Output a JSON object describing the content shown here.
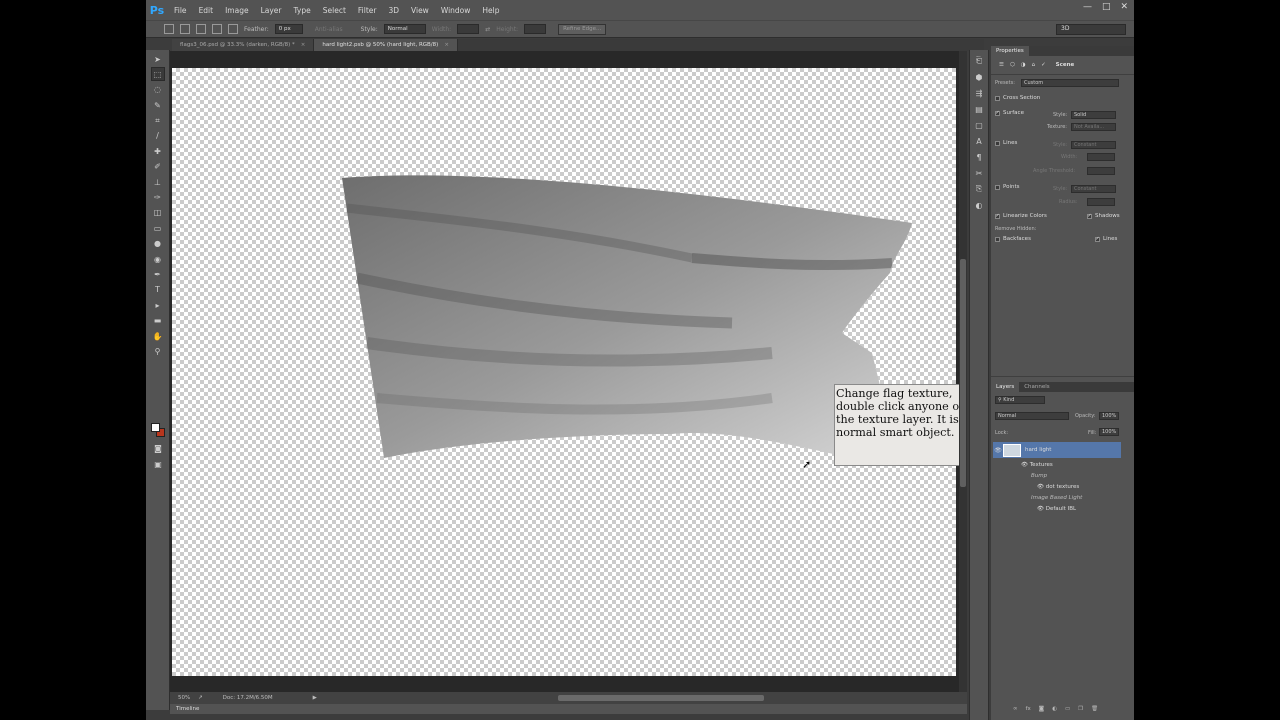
{
  "app": {
    "logo": "Ps"
  },
  "menu": [
    "File",
    "Edit",
    "Image",
    "Layer",
    "Type",
    "Select",
    "Filter",
    "3D",
    "View",
    "Window",
    "Help"
  ],
  "window_controls": {
    "minimize": "—",
    "maximize": "□",
    "close": "✕"
  },
  "options": {
    "feather_label": "Feather:",
    "feather_value": "0 px",
    "antialias_label": "Anti-alias",
    "style_label": "Style:",
    "style_value": "Normal",
    "width_label": "Width:",
    "height_label": "Height:",
    "refine_edge": "Refine Edge...",
    "workspace": "3D"
  },
  "tabs": [
    {
      "label": "flags3_06.psd @ 33.3% (darken, RGB/8) *",
      "close": "×"
    },
    {
      "label": "hard light2.psb @ 50% (hard light, RGB/8)",
      "close": "×"
    }
  ],
  "tooltip": "Change flag texture, double click anyone of the texture layer. It is normal smart object.",
  "status": {
    "zoom": "50%",
    "doc": "Doc: 17.2M/6.50M",
    "timeline": "Timeline"
  },
  "properties": {
    "tab": "Properties",
    "scene_label": "Scene",
    "presets_label": "Presets:",
    "presets_value": "Custom",
    "cross_section": "Cross Section",
    "surface": "Surface",
    "surface_style_label": "Style:",
    "surface_style_value": "Solid",
    "texture_label": "Texture:",
    "texture_value": "Not Availa...",
    "lines": "Lines",
    "lines_style_label": "Style:",
    "lines_style_value": "Constant",
    "width_label": "Width:",
    "angle_label": "Angle Threshold:",
    "points": "Points",
    "points_style_label": "Style:",
    "points_style_value": "Constant",
    "radius_label": "Radius:",
    "linearize": "Linearize Colors",
    "shadows": "Shadows",
    "remove_hidden": "Remove Hidden:",
    "backfaces": "Backfaces",
    "lines2": "Lines"
  },
  "layers": {
    "tabs": [
      "Layers",
      "Channels"
    ],
    "kind": "Kind",
    "blend": "Normal",
    "opacity_label": "Opacity:",
    "opacity_value": "100%",
    "lock_label": "Lock:",
    "fill_label": "Fill:",
    "fill_value": "100%",
    "items": [
      {
        "name": "hard light"
      },
      {
        "name": "Textures"
      },
      {
        "name": "Bump"
      },
      {
        "name": "dot textures"
      },
      {
        "name": "Image Based Light"
      },
      {
        "name": "Default IBL"
      }
    ]
  }
}
